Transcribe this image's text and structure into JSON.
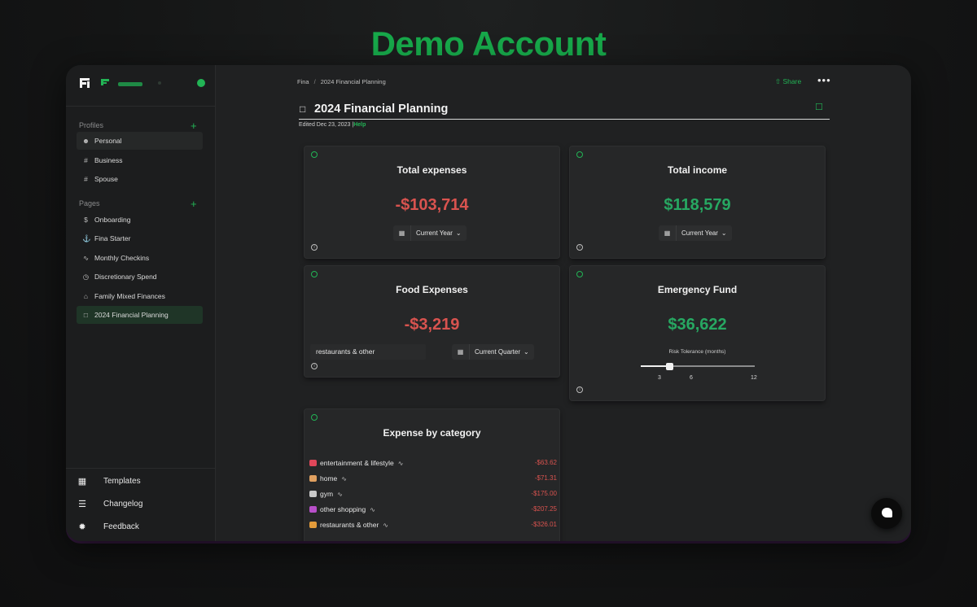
{
  "banner": "Demo Account",
  "sidebar": {
    "profiles_header": "Profiles",
    "profiles": [
      {
        "label": "Personal",
        "icon": "person-icon"
      },
      {
        "label": "Business",
        "icon": "hash-icon"
      },
      {
        "label": "Spouse",
        "icon": "hash-icon"
      }
    ],
    "pages_header": "Pages",
    "pages": [
      {
        "label": "Onboarding",
        "icon": "dollar-icon"
      },
      {
        "label": "Fina Starter",
        "icon": "anchor-icon"
      },
      {
        "label": "Monthly Checkins",
        "icon": "pulse-icon"
      },
      {
        "label": "Discretionary Spend",
        "icon": "clock-icon"
      },
      {
        "label": "Family Mixed Finances",
        "icon": "home-icon"
      },
      {
        "label": "2024 Financial Planning",
        "icon": "clipboard-icon"
      }
    ],
    "bottom": [
      {
        "label": "Templates",
        "icon": "templates-icon"
      },
      {
        "label": "Changelog",
        "icon": "checklist-icon"
      },
      {
        "label": "Feedback",
        "icon": "bug-icon"
      }
    ]
  },
  "header": {
    "breadcrumb": [
      "Fina",
      "2024 Financial Planning"
    ],
    "share": "Share",
    "title": "2024 Financial Planning",
    "edited": "Edited Dec 23, 2023 |",
    "help": "Help"
  },
  "cards": {
    "total_expenses": {
      "title": "Total expenses",
      "value": "-$103,714",
      "period": "Current Year"
    },
    "total_income": {
      "title": "Total income",
      "value": "$118,579",
      "period": "Current Year"
    },
    "food_expenses": {
      "title": "Food Expenses",
      "value": "-$3,219",
      "filter": "restaurants & other",
      "period": "Current Quarter"
    },
    "emergency_fund": {
      "title": "Emergency Fund",
      "value": "$36,622",
      "slider_label": "Risk Tolerance (months)",
      "ticks": [
        "3",
        "6",
        "12"
      ],
      "slider_value": 3,
      "slider_max": 12
    },
    "expense_by_category": {
      "title": "Expense by category",
      "rows": [
        {
          "label": "entertainment & lifestyle",
          "amount": "-$63.62",
          "color": "#e0475a"
        },
        {
          "label": "home",
          "amount": "-$71.31",
          "color": "#e0a060"
        },
        {
          "label": "gym",
          "amount": "-$175.00",
          "color": "#c9c9c9"
        },
        {
          "label": "other shopping",
          "amount": "-$207.25",
          "color": "#b84fc9"
        },
        {
          "label": "restaurants & other",
          "amount": "-$326.01",
          "color": "#e39b3a"
        }
      ]
    }
  },
  "colors": {
    "accent": "#22b455",
    "negative": "#d9534f",
    "positive": "#27a862"
  }
}
